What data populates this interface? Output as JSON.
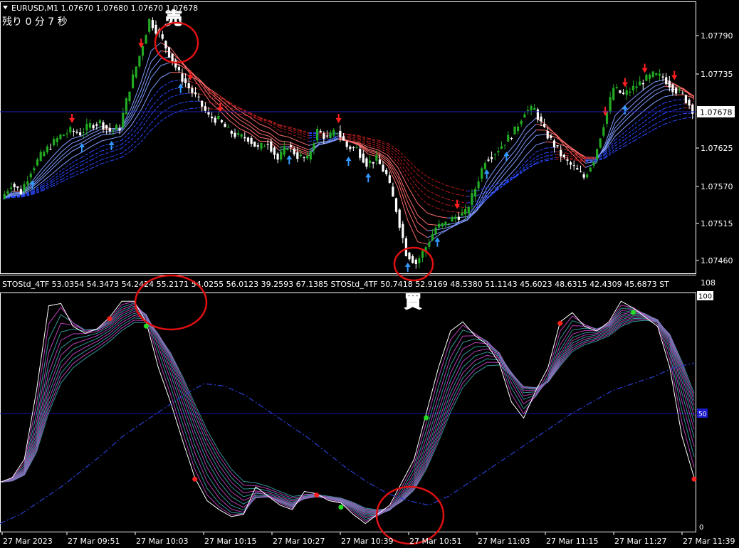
{
  "header": {
    "symbol_line": "EURUSD,M1  1.07670 1.07680 1.07670 1.07678",
    "timer_text": "残り 0 分 7 秒"
  },
  "annotations": {
    "sell_label": "売",
    "buy_label": "買"
  },
  "price_panel": {
    "current_price": "1.07678",
    "y_ticks": [
      "1.07790",
      "1.07735",
      "1.07678",
      "1.07625",
      "1.07570",
      "1.07515",
      "1.07460"
    ]
  },
  "indicator_panel": {
    "info_text": "STOStd_4TF 53.0354 54.3473 54.2424 55.2171 54.0255 56.0123 39.2593 67.1385  STOStd_4TF 50.7418 52.9169 48.5380 51.1143 45.6023 48.6315 42.4309 45.6873  ST",
    "y_ticks": [
      "108",
      "100",
      "50",
      "0"
    ]
  },
  "time_axis": {
    "labels": [
      "27 Mar 2023",
      "27 Mar 09:51",
      "27 Mar 10:03",
      "27 Mar 10:15",
      "27 Mar 10:27",
      "27 Mar 10:39",
      "27 Mar 10:51",
      "27 Mar 11:03",
      "27 Mar 11:15",
      "27 Mar 11:27",
      "27 Mar 11:39"
    ]
  },
  "colors": {
    "background": "#000000",
    "bull": "#22aa22",
    "bear": "#ffffff",
    "sell_arrow": "#ff2020",
    "buy_arrow": "#3399ff",
    "circle": "#e01010",
    "stoch_main": "#ffffff",
    "stoch_magenta": "#cc44cc",
    "stoch_teal": "#3aa6a6",
    "stoch_slow": "#2a3fd0",
    "level_line": "#1010a0"
  },
  "chart_data": [
    {
      "type": "line",
      "title": "EURUSD,M1",
      "ylim": [
        1.07445,
        1.07815
      ],
      "price_path": [
        1.07545,
        1.07566,
        1.07555,
        1.07585,
        1.07605,
        1.0762,
        1.07633,
        1.0764,
        1.07637,
        1.07648,
        1.07652,
        1.0764,
        1.07645,
        1.077,
        1.07745,
        1.07795,
        1.07775,
        1.07748,
        1.0772,
        1.077,
        1.07682,
        1.0766,
        1.07655,
        1.0764,
        1.07632,
        1.0763,
        1.07615,
        1.07625,
        1.076,
        1.0762,
        1.07605,
        1.076,
        1.0764,
        1.0763,
        1.0764,
        1.07618,
        1.07615,
        1.07595,
        1.076,
        1.07578,
        1.0753,
        1.0747,
        1.07455,
        1.07478,
        1.07505,
        1.0751,
        1.0752,
        1.07525,
        1.0756,
        1.076,
        1.0761,
        1.07625,
        1.0764,
        1.07668,
        1.0767,
        1.0764,
        1.0762,
        1.076,
        1.07588,
        1.07575,
        1.076,
        1.0765,
        1.077,
        1.0769,
        1.077,
        1.0771,
        1.07718,
        1.07715,
        1.077,
        1.0769,
        1.0767
      ],
      "sell_signals": [
        7,
        14,
        19,
        22,
        34,
        46,
        61,
        63,
        65,
        68
      ],
      "buy_signals": [
        3,
        8,
        11,
        18,
        29,
        35,
        37,
        41,
        44,
        49,
        51,
        63
      ]
    },
    {
      "type": "line",
      "title": "STOStd_4TF",
      "ylim": [
        0,
        100
      ],
      "level": 50,
      "series": [
        {
          "values": [
            20,
            22,
            30,
            60,
            97,
            98,
            88,
            85,
            87,
            92,
            99,
            99,
            90,
            70,
            55,
            38,
            22,
            12,
            8,
            5,
            6,
            18,
            14,
            10,
            8,
            16,
            15,
            12,
            11,
            6,
            2,
            6,
            10,
            20,
            30,
            50,
            70,
            86,
            90,
            84,
            80,
            72,
            55,
            48,
            60,
            70,
            90,
            94,
            88,
            86,
            90,
            99,
            96,
            92,
            88,
            70,
            40,
            22
          ]
        },
        {
          "values": [
            2,
            6,
            12,
            18,
            25,
            32,
            40,
            46,
            52,
            58,
            63,
            62,
            58,
            52,
            46,
            40,
            33,
            26,
            20,
            15,
            12,
            10,
            14,
            20,
            26,
            32,
            38,
            44,
            50,
            55,
            60,
            63,
            66,
            70,
            72
          ]
        }
      ],
      "sell_signals": [
        9,
        16,
        26,
        46,
        57
      ],
      "buy_signals": [
        12,
        28,
        35,
        52
      ]
    }
  ]
}
